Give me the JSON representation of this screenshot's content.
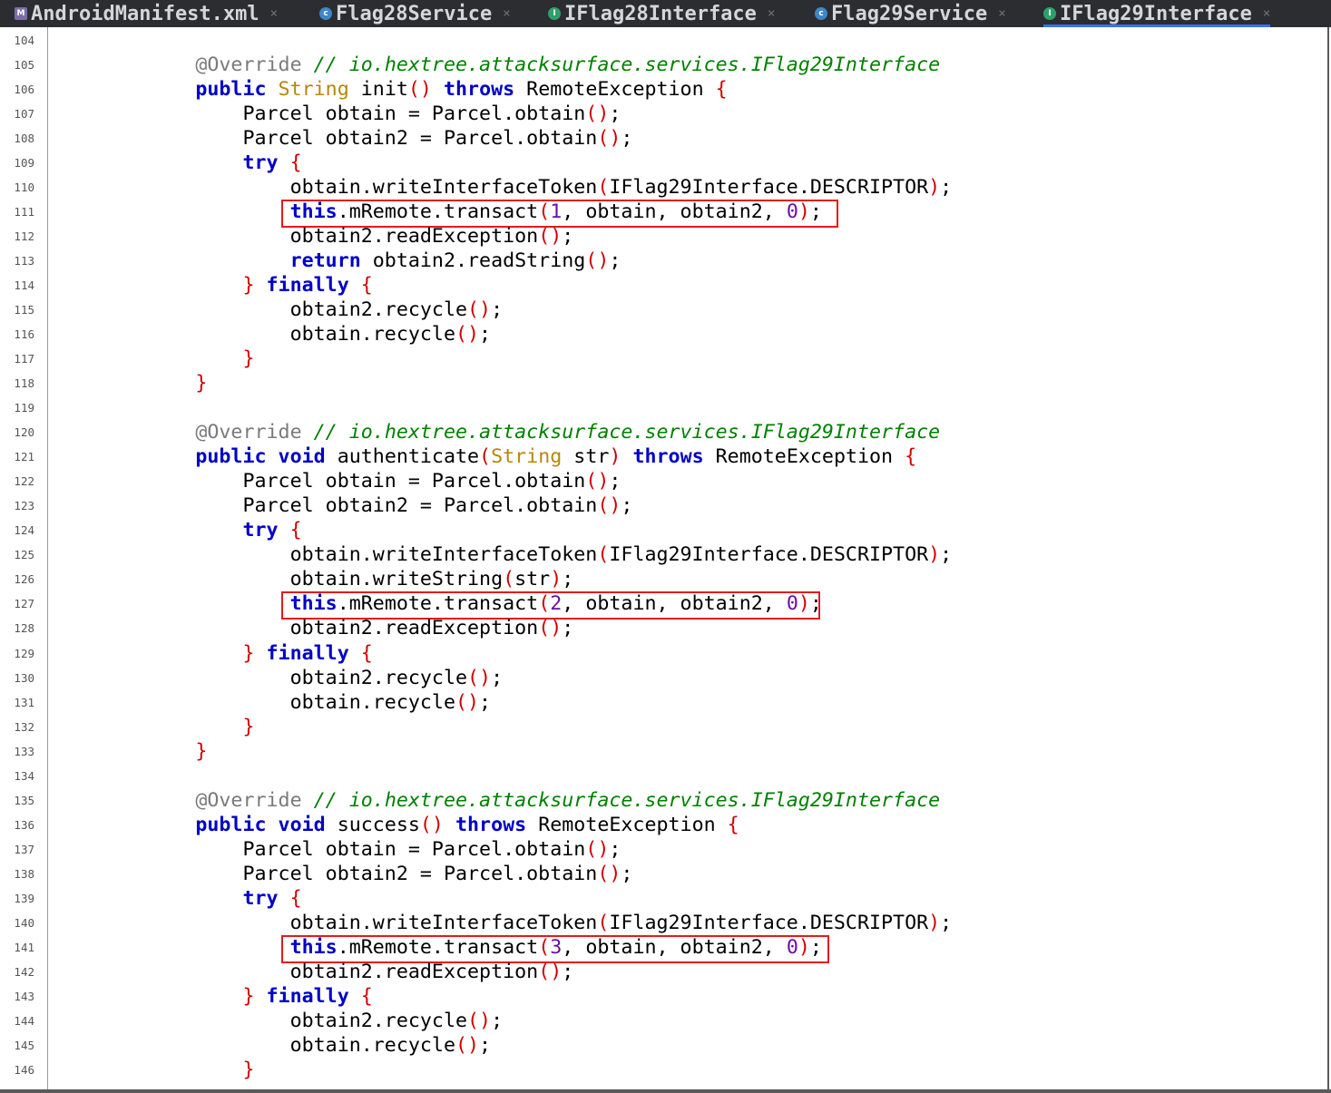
{
  "tabs": [
    {
      "label": "AndroidManifest.xml",
      "icon": "manifest-icon",
      "active": false,
      "close": "×"
    },
    {
      "label": "Flag28Service",
      "icon": "class-icon",
      "active": false,
      "close": "×"
    },
    {
      "label": "IFlag28Interface",
      "icon": "interface-icon",
      "active": false,
      "close": "×"
    },
    {
      "label": "Flag29Service",
      "icon": "class-icon",
      "active": false,
      "close": "×"
    },
    {
      "label": "IFlag29Interface",
      "icon": "interface-icon",
      "active": true,
      "close": "×"
    }
  ],
  "colors": {
    "keyword": "#0000c8",
    "type": "#b8860b",
    "annotation": "#7a7a7a",
    "comment": "#008000",
    "bracket": "#d00000",
    "number": "#6a0dad",
    "highlight_box": "#e31b1b",
    "tabbar_bg": "#2b2d30"
  },
  "code": {
    "lines": [
      {
        "n": "104",
        "tokens": []
      },
      {
        "n": "105",
        "tokens": [
          [
            "an",
            "            @Override "
          ],
          [
            "cm",
            "// io.hextree.attacksurface.services.IFlag29Interface"
          ]
        ]
      },
      {
        "n": "106",
        "tokens": [
          [
            "kw",
            "            public "
          ],
          [
            "ty",
            "String"
          ],
          [
            "p",
            " init"
          ],
          [
            "br",
            "()"
          ],
          [
            "kw",
            " throws"
          ],
          [
            "p",
            " RemoteException "
          ],
          [
            "br",
            "{"
          ]
        ]
      },
      {
        "n": "107",
        "tokens": [
          [
            "p",
            "                Parcel obtain = Parcel.obtain"
          ],
          [
            "br",
            "()"
          ],
          [
            "p",
            ";"
          ]
        ]
      },
      {
        "n": "108",
        "tokens": [
          [
            "p",
            "                Parcel obtain2 = Parcel.obtain"
          ],
          [
            "br",
            "()"
          ],
          [
            "p",
            ";"
          ]
        ]
      },
      {
        "n": "109",
        "tokens": [
          [
            "kw",
            "                try"
          ],
          [
            "br",
            " {"
          ]
        ]
      },
      {
        "n": "110",
        "tokens": [
          [
            "p",
            "                    obtain.writeInterfaceToken"
          ],
          [
            "br",
            "("
          ],
          [
            "p",
            "IFlag29Interface.DESCRIPTOR"
          ],
          [
            "br",
            ")"
          ],
          [
            "p",
            ";"
          ]
        ]
      },
      {
        "n": "111",
        "tokens": [
          [
            "kw",
            "                    this"
          ],
          [
            "p",
            ".mRemote.transact"
          ],
          [
            "br",
            "("
          ],
          [
            "nm",
            "1"
          ],
          [
            "p",
            ", obtain, obtain2, "
          ],
          [
            "nm",
            "0"
          ],
          [
            "br",
            ")"
          ],
          [
            "p",
            ";"
          ]
        ]
      },
      {
        "n": "112",
        "tokens": [
          [
            "p",
            "                    obtain2.readException"
          ],
          [
            "br",
            "()"
          ],
          [
            "p",
            ";"
          ]
        ]
      },
      {
        "n": "113",
        "tokens": [
          [
            "kw",
            "                    return"
          ],
          [
            "p",
            " obtain2.readString"
          ],
          [
            "br",
            "()"
          ],
          [
            "p",
            ";"
          ]
        ]
      },
      {
        "n": "114",
        "tokens": [
          [
            "br",
            "                } "
          ],
          [
            "kw",
            "finally"
          ],
          [
            "br",
            " {"
          ]
        ]
      },
      {
        "n": "115",
        "tokens": [
          [
            "p",
            "                    obtain2.recycle"
          ],
          [
            "br",
            "()"
          ],
          [
            "p",
            ";"
          ]
        ]
      },
      {
        "n": "116",
        "tokens": [
          [
            "p",
            "                    obtain.recycle"
          ],
          [
            "br",
            "()"
          ],
          [
            "p",
            ";"
          ]
        ]
      },
      {
        "n": "117",
        "tokens": [
          [
            "br",
            "                }"
          ]
        ]
      },
      {
        "n": "118",
        "tokens": [
          [
            "br",
            "            }"
          ]
        ]
      },
      {
        "n": "119",
        "tokens": []
      },
      {
        "n": "120",
        "tokens": [
          [
            "an",
            "            @Override "
          ],
          [
            "cm",
            "// io.hextree.attacksurface.services.IFlag29Interface"
          ]
        ]
      },
      {
        "n": "121",
        "tokens": [
          [
            "kw",
            "            public void"
          ],
          [
            "p",
            " authenticate"
          ],
          [
            "br",
            "("
          ],
          [
            "ty",
            "String"
          ],
          [
            "p",
            " str"
          ],
          [
            "br",
            ")"
          ],
          [
            "kw",
            " throws"
          ],
          [
            "p",
            " RemoteException "
          ],
          [
            "br",
            "{"
          ]
        ]
      },
      {
        "n": "122",
        "tokens": [
          [
            "p",
            "                Parcel obtain = Parcel.obtain"
          ],
          [
            "br",
            "()"
          ],
          [
            "p",
            ";"
          ]
        ]
      },
      {
        "n": "123",
        "tokens": [
          [
            "p",
            "                Parcel obtain2 = Parcel.obtain"
          ],
          [
            "br",
            "()"
          ],
          [
            "p",
            ";"
          ]
        ]
      },
      {
        "n": "124",
        "tokens": [
          [
            "kw",
            "                try"
          ],
          [
            "br",
            " {"
          ]
        ]
      },
      {
        "n": "125",
        "tokens": [
          [
            "p",
            "                    obtain.writeInterfaceToken"
          ],
          [
            "br",
            "("
          ],
          [
            "p",
            "IFlag29Interface.DESCRIPTOR"
          ],
          [
            "br",
            ")"
          ],
          [
            "p",
            ";"
          ]
        ]
      },
      {
        "n": "126",
        "tokens": [
          [
            "p",
            "                    obtain.writeString"
          ],
          [
            "br",
            "("
          ],
          [
            "p",
            "str"
          ],
          [
            "br",
            ")"
          ],
          [
            "p",
            ";"
          ]
        ]
      },
      {
        "n": "127",
        "tokens": [
          [
            "kw",
            "                    this"
          ],
          [
            "p",
            ".mRemote.transact"
          ],
          [
            "br",
            "("
          ],
          [
            "nm",
            "2"
          ],
          [
            "p",
            ", obtain, obtain2, "
          ],
          [
            "nm",
            "0"
          ],
          [
            "br",
            ")"
          ],
          [
            "p",
            ";"
          ]
        ]
      },
      {
        "n": "128",
        "tokens": [
          [
            "p",
            "                    obtain2.readException"
          ],
          [
            "br",
            "()"
          ],
          [
            "p",
            ";"
          ]
        ]
      },
      {
        "n": "129",
        "tokens": [
          [
            "br",
            "                } "
          ],
          [
            "kw",
            "finally"
          ],
          [
            "br",
            " {"
          ]
        ]
      },
      {
        "n": "130",
        "tokens": [
          [
            "p",
            "                    obtain2.recycle"
          ],
          [
            "br",
            "()"
          ],
          [
            "p",
            ";"
          ]
        ]
      },
      {
        "n": "131",
        "tokens": [
          [
            "p",
            "                    obtain.recycle"
          ],
          [
            "br",
            "()"
          ],
          [
            "p",
            ";"
          ]
        ]
      },
      {
        "n": "132",
        "tokens": [
          [
            "br",
            "                }"
          ]
        ]
      },
      {
        "n": "133",
        "tokens": [
          [
            "br",
            "            }"
          ]
        ]
      },
      {
        "n": "134",
        "tokens": []
      },
      {
        "n": "135",
        "tokens": [
          [
            "an",
            "            @Override "
          ],
          [
            "cm",
            "// io.hextree.attacksurface.services.IFlag29Interface"
          ]
        ]
      },
      {
        "n": "136",
        "tokens": [
          [
            "kw",
            "            public void"
          ],
          [
            "p",
            " success"
          ],
          [
            "br",
            "()"
          ],
          [
            "kw",
            " throws"
          ],
          [
            "p",
            " RemoteException "
          ],
          [
            "br",
            "{"
          ]
        ]
      },
      {
        "n": "137",
        "tokens": [
          [
            "p",
            "                Parcel obtain = Parcel.obtain"
          ],
          [
            "br",
            "()"
          ],
          [
            "p",
            ";"
          ]
        ]
      },
      {
        "n": "138",
        "tokens": [
          [
            "p",
            "                Parcel obtain2 = Parcel.obtain"
          ],
          [
            "br",
            "()"
          ],
          [
            "p",
            ";"
          ]
        ]
      },
      {
        "n": "139",
        "tokens": [
          [
            "kw",
            "                try"
          ],
          [
            "br",
            " {"
          ]
        ]
      },
      {
        "n": "140",
        "tokens": [
          [
            "p",
            "                    obtain.writeInterfaceToken"
          ],
          [
            "br",
            "("
          ],
          [
            "p",
            "IFlag29Interface.DESCRIPTOR"
          ],
          [
            "br",
            ")"
          ],
          [
            "p",
            ";"
          ]
        ]
      },
      {
        "n": "141",
        "tokens": [
          [
            "kw",
            "                    this"
          ],
          [
            "p",
            ".mRemote.transact"
          ],
          [
            "br",
            "("
          ],
          [
            "nm",
            "3"
          ],
          [
            "p",
            ", obtain, obtain2, "
          ],
          [
            "nm",
            "0"
          ],
          [
            "br",
            ")"
          ],
          [
            "p",
            ";"
          ]
        ]
      },
      {
        "n": "142",
        "tokens": [
          [
            "p",
            "                    obtain2.readException"
          ],
          [
            "br",
            "()"
          ],
          [
            "p",
            ";"
          ]
        ]
      },
      {
        "n": "143",
        "tokens": [
          [
            "br",
            "                } "
          ],
          [
            "kw",
            "finally"
          ],
          [
            "br",
            " {"
          ]
        ]
      },
      {
        "n": "144",
        "tokens": [
          [
            "p",
            "                    obtain2.recycle"
          ],
          [
            "br",
            "()"
          ],
          [
            "p",
            ";"
          ]
        ]
      },
      {
        "n": "145",
        "tokens": [
          [
            "p",
            "                    obtain.recycle"
          ],
          [
            "br",
            "()"
          ],
          [
            "p",
            ";"
          ]
        ]
      },
      {
        "n": "146",
        "tokens": [
          [
            "br",
            "                }"
          ]
        ]
      }
    ],
    "highlighted_lines": [
      "111",
      "127",
      "141"
    ]
  }
}
